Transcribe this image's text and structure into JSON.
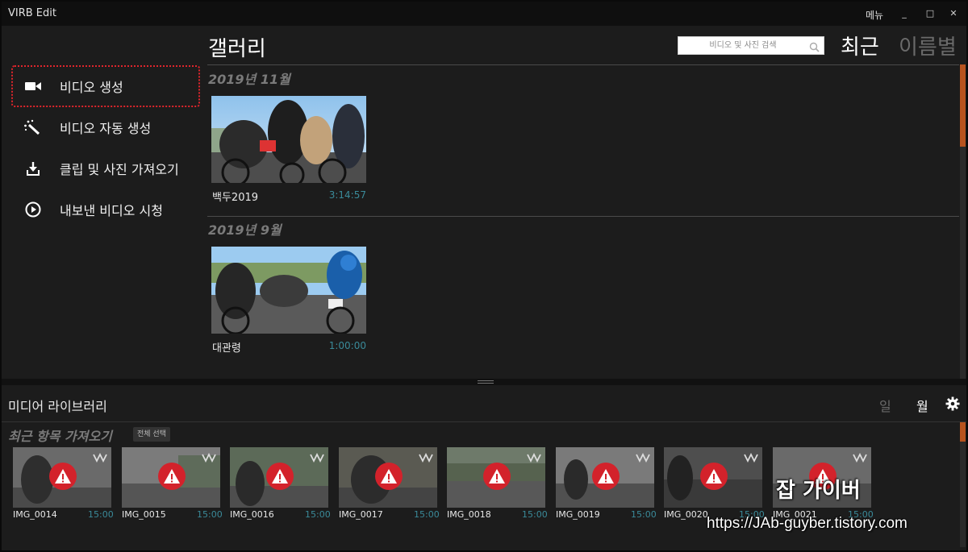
{
  "window": {
    "title": "VIRB Edit",
    "menu_label": "메뉴",
    "minimize": "_",
    "maximize": "□",
    "close": "✕"
  },
  "sidebar": {
    "items": [
      {
        "label": "비디오 생성",
        "icon": "video-camera-icon",
        "selected": true
      },
      {
        "label": "비디오 자동 생성",
        "icon": "magic-wand-icon"
      },
      {
        "label": "클립 및 사진 가져오기",
        "icon": "import-download-icon"
      },
      {
        "label": "내보낸 비디오 시청",
        "icon": "play-circle-icon"
      }
    ]
  },
  "gallery": {
    "title": "갤러리",
    "search_placeholder": "비디오 및 사진 검색",
    "sort_recent": "최근",
    "sort_name": "이름별",
    "groups": [
      {
        "month": "2019년 11월",
        "clips": [
          {
            "name": "백두2019",
            "duration": "3:14:57"
          }
        ]
      },
      {
        "month": "2019년 9월",
        "clips": [
          {
            "name": "대관령",
            "duration": "1:00:00"
          }
        ]
      }
    ]
  },
  "library": {
    "title": "미디어 라이브러리",
    "view_day": "일",
    "view_month": "월",
    "section_title": "최근 항목 가져오기",
    "select_all": "전체 선택",
    "items": [
      {
        "name": "IMG_0014",
        "duration": "15:00"
      },
      {
        "name": "IMG_0015",
        "duration": "15:00"
      },
      {
        "name": "IMG_0016",
        "duration": "15:00"
      },
      {
        "name": "IMG_0017",
        "duration": "15:00"
      },
      {
        "name": "IMG_0018",
        "duration": "15:00"
      },
      {
        "name": "IMG_0019",
        "duration": "15:00"
      },
      {
        "name": "IMG_0020",
        "duration": "15:00"
      },
      {
        "name": "IMG_0021",
        "duration": "15:00"
      }
    ]
  },
  "watermark": {
    "title": "잡 가이버",
    "url": "https://JAb-guyber.tistory.com"
  },
  "colors": {
    "accent": "#b8531f",
    "selection_outline": "#e0252c",
    "duration_text": "#3a8a99",
    "warning": "#d3222b"
  }
}
